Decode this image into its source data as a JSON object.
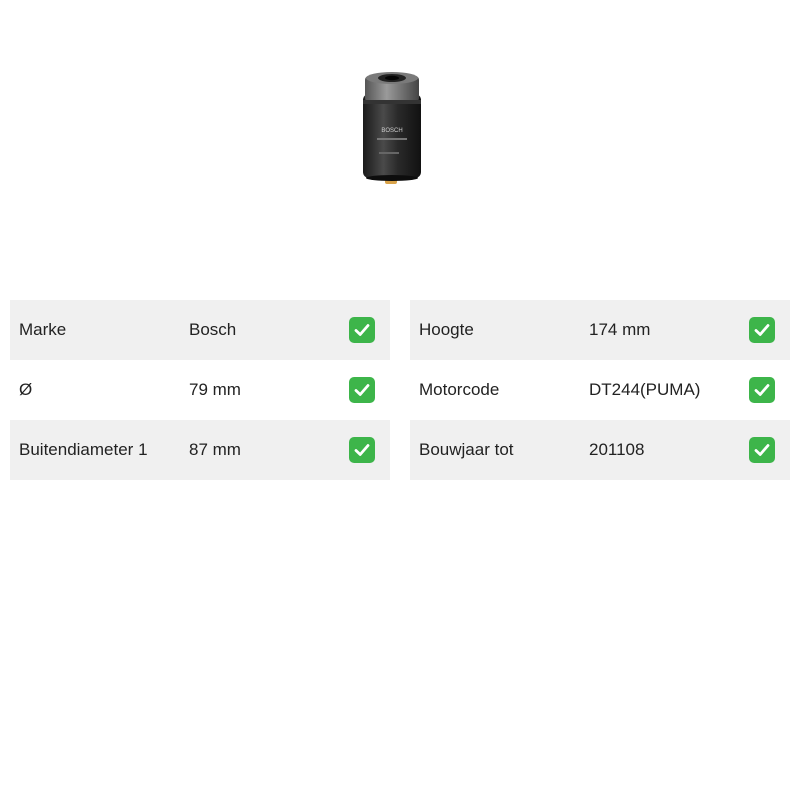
{
  "product": {
    "image_icon": "fuel-filter-product-image",
    "brand_marking": "BOSCH"
  },
  "specs": {
    "left": [
      {
        "label": "Marke",
        "value": "Bosch",
        "status_icon": "check-icon"
      },
      {
        "label": "Ø",
        "value": "79 mm",
        "status_icon": "check-icon"
      },
      {
        "label": "Buitendiameter 1",
        "value": "87 mm",
        "status_icon": "check-icon"
      }
    ],
    "right": [
      {
        "label": "Hoogte",
        "value": "174 mm",
        "status_icon": "check-icon"
      },
      {
        "label": "Motorcode",
        "value": "DT244(PUMA)",
        "status_icon": "check-icon"
      },
      {
        "label": "Bouwjaar tot",
        "value": "201108",
        "status_icon": "check-icon"
      }
    ]
  },
  "colors": {
    "row_shade": "#f0f0f0",
    "check_bg": "#3db54a",
    "check_mark": "#ffffff"
  }
}
